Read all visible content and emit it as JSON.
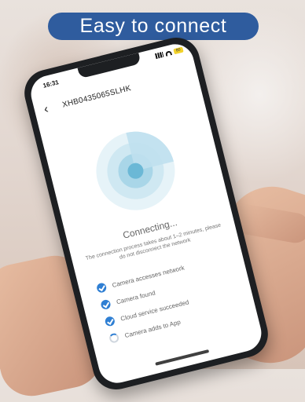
{
  "banner": {
    "text": "Easy to connect"
  },
  "phone": {
    "status": {
      "time": "16:31",
      "battery_label": "80"
    },
    "header": {
      "device_id": "XHB0435065SLHK"
    },
    "connecting": {
      "title": "Connecting..."
    },
    "description": "The connection process takes about 1–2 minutes, please do not disconnect the network",
    "steps": [
      {
        "label": "Camera accesses network",
        "state": "done"
      },
      {
        "label": "Camera found",
        "state": "done"
      },
      {
        "label": "Cloud service succeeded",
        "state": "done"
      },
      {
        "label": "Camera adds to App",
        "state": "in-progress"
      }
    ]
  },
  "colors": {
    "banner_bg": "#2f5c9e",
    "accent": "#2f7fd3",
    "phone_body": "#1d1f22"
  }
}
